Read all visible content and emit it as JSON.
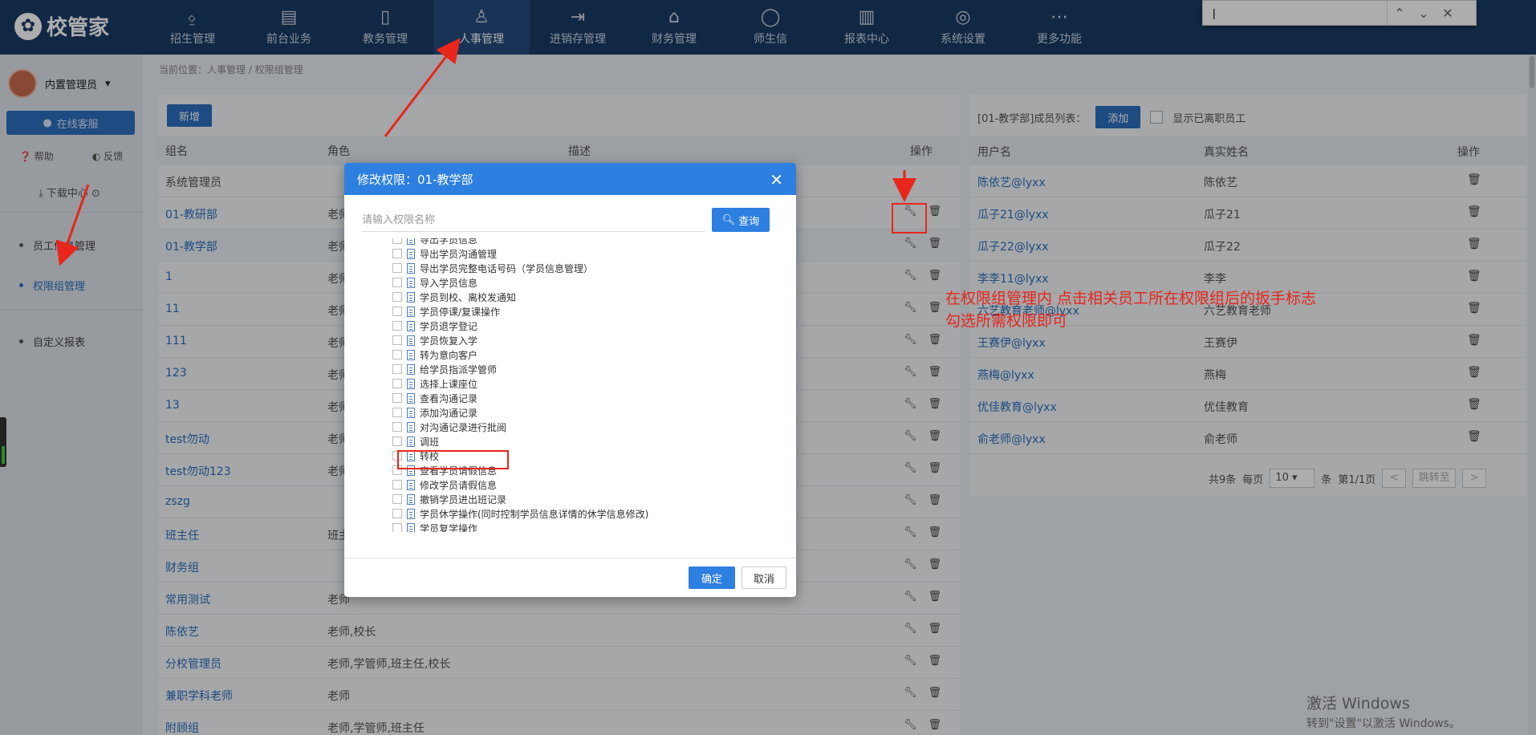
{
  "app": {
    "logo": "校管家"
  },
  "nav": [
    {
      "label": "招生管理",
      "icon": "person-add-icon"
    },
    {
      "label": "前台业务",
      "icon": "desk-icon"
    },
    {
      "label": "教务管理",
      "icon": "book-icon"
    },
    {
      "label": "人事管理",
      "icon": "person-icon"
    },
    {
      "label": "进销存管理",
      "icon": "inventory-icon"
    },
    {
      "label": "财务管理",
      "icon": "finance-icon"
    },
    {
      "label": "师生信",
      "icon": "message-icon"
    },
    {
      "label": "报表中心",
      "icon": "chart-icon"
    },
    {
      "label": "系统设置",
      "icon": "settings-icon"
    },
    {
      "label": "更多功能",
      "icon": "more-icon"
    }
  ],
  "findbar": {
    "value": "|",
    "up": "⌃",
    "down": "⌄",
    "close": "✕"
  },
  "sidebar": {
    "user": "内置管理员",
    "online": "在线客服",
    "help": "帮助",
    "feedback": "反馈",
    "download": "下载中心",
    "items": [
      "员工信息管理",
      "权限组管理",
      "自定义报表"
    ]
  },
  "breadcrumb": "当前位置：人事管理 / 权限组管理",
  "groups": {
    "new_label": "新增",
    "headers": [
      "组名",
      "角色",
      "描述",
      "操作"
    ],
    "rows": [
      {
        "name": "系统管理员",
        "role": ""
      },
      {
        "name": "01-教研部",
        "role": "老师"
      },
      {
        "name": "01-教学部",
        "role": "老师"
      },
      {
        "name": "1",
        "role": "老师"
      },
      {
        "name": "11",
        "role": "老师"
      },
      {
        "name": "111",
        "role": "老师"
      },
      {
        "name": "123",
        "role": "老师"
      },
      {
        "name": "13",
        "role": "老师"
      },
      {
        "name": "test勿动",
        "role": "老师"
      },
      {
        "name": "test勿动123",
        "role": "老师"
      },
      {
        "name": "zszg",
        "role": ""
      },
      {
        "name": "班主任",
        "role": "班主任"
      },
      {
        "name": "财务组",
        "role": ""
      },
      {
        "name": "常用测试",
        "role": "老师"
      },
      {
        "name": "陈依艺",
        "role": "老师,校长"
      },
      {
        "name": "分校管理员",
        "role": "老师,学管师,班主任,校长"
      },
      {
        "name": "兼职学科老师",
        "role": "老师"
      },
      {
        "name": "附顾组",
        "role": "老师,学管师,班主任"
      }
    ]
  },
  "members": {
    "title": "[01-教学部]成员列表：",
    "add_label": "添加",
    "show_resigned": "显示已离职员工",
    "headers": [
      "用户名",
      "真实姓名",
      "操作"
    ],
    "rows": [
      {
        "user": "陈依艺@lyxx",
        "real": "陈依艺"
      },
      {
        "user": "瓜子21@lyxx",
        "real": "瓜子21"
      },
      {
        "user": "瓜子22@lyxx",
        "real": "瓜子22"
      },
      {
        "user": "李李11@lyxx",
        "real": "李李"
      },
      {
        "user": "六艺教育老师@lyxx",
        "real": "六艺教育老师"
      },
      {
        "user": "王赛伊@lyxx",
        "real": "王赛伊"
      },
      {
        "user": "燕梅@lyxx",
        "real": "燕梅"
      },
      {
        "user": "优佳教育@lyxx",
        "real": "优佳教育"
      },
      {
        "user": "俞老师@lyxx",
        "real": "俞老师"
      }
    ],
    "pager": {
      "total": "共9条",
      "per_page": "每页",
      "page_size": "10",
      "unit": "条",
      "pages": "第1/1页",
      "prev": "<",
      "jump": "跳转至",
      "next": ">"
    }
  },
  "dialog": {
    "title": "修改权限：01-教学部",
    "placeholder": "请输入权限名称",
    "query": "查询",
    "items": [
      "导出学员信息",
      "导出学员沟通管理",
      "导出学员完整电话号码（学员信息管理）",
      "导入学员信息",
      "学员到校、离校发通知",
      "学员停课/复课操作",
      "学员退学登记",
      "学员恢复入学",
      "转为意向客户",
      "给学员指派学管师",
      "选择上课座位",
      "查看沟通记录",
      "添加沟通记录",
      "对沟通记录进行批阅",
      "调班",
      "转校",
      "查看学员请假信息",
      "修改学员请假信息",
      "撤销学员进出班记录",
      "学员休学操作(同时控制学员信息详情的休学信息修改)",
      "学员复学操作"
    ],
    "ok": "确定",
    "cancel": "取消"
  },
  "annotation": {
    "line1": "在权限组管理内  点击相关员工所在权限组后的扳手标志",
    "line2": "勾选所需权限即可"
  },
  "watermark": {
    "line1": "激活 Windows",
    "line2": "转到\"设置\"以激活 Windows。"
  },
  "colors": {
    "nav_bg": "#1a3c66",
    "accent": "#2d7fe0",
    "annotation": "#e8261b"
  }
}
